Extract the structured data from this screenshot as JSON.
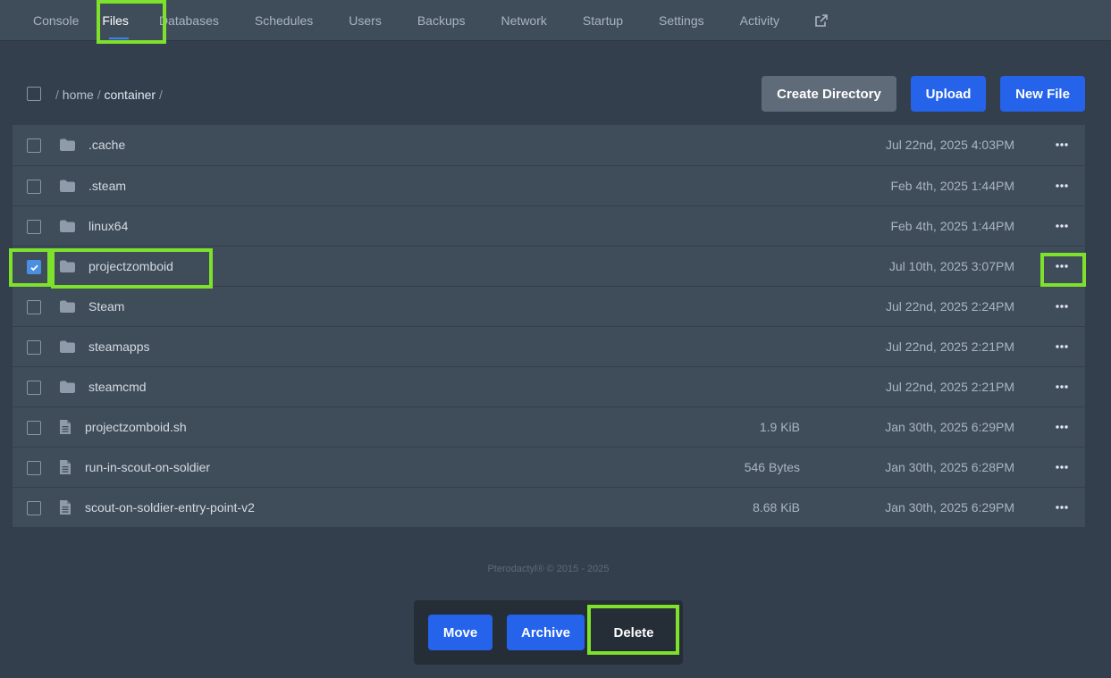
{
  "nav": {
    "tabs": [
      {
        "label": "Console"
      },
      {
        "label": "Files"
      },
      {
        "label": "Databases"
      },
      {
        "label": "Schedules"
      },
      {
        "label": "Users"
      },
      {
        "label": "Backups"
      },
      {
        "label": "Network"
      },
      {
        "label": "Startup"
      },
      {
        "label": "Settings"
      },
      {
        "label": "Activity"
      }
    ],
    "active_tab": "Files",
    "external_icon": "external-link-icon"
  },
  "breadcrumb": {
    "sep": "/",
    "parts": [
      "home",
      "container"
    ]
  },
  "actions": {
    "create_directory": "Create Directory",
    "upload": "Upload",
    "new_file": "New File"
  },
  "files": [
    {
      "name": ".cache",
      "type": "folder",
      "size": "",
      "date": "Jul 22nd, 2025 4:03PM",
      "checked": false
    },
    {
      "name": ".steam",
      "type": "folder",
      "size": "",
      "date": "Feb 4th, 2025 1:44PM",
      "checked": false
    },
    {
      "name": "linux64",
      "type": "folder",
      "size": "",
      "date": "Feb 4th, 2025 1:44PM",
      "checked": false
    },
    {
      "name": "projectzomboid",
      "type": "folder",
      "size": "",
      "date": "Jul 10th, 2025 3:07PM",
      "checked": true
    },
    {
      "name": "Steam",
      "type": "folder",
      "size": "",
      "date": "Jul 22nd, 2025 2:24PM",
      "checked": false
    },
    {
      "name": "steamapps",
      "type": "folder",
      "size": "",
      "date": "Jul 22nd, 2025 2:21PM",
      "checked": false
    },
    {
      "name": "steamcmd",
      "type": "folder",
      "size": "",
      "date": "Jul 22nd, 2025 2:21PM",
      "checked": false
    },
    {
      "name": "projectzomboid.sh",
      "type": "file",
      "size": "1.9 KiB",
      "date": "Jan 30th, 2025 6:29PM",
      "checked": false
    },
    {
      "name": "run-in-scout-on-soldier",
      "type": "file",
      "size": "546 Bytes",
      "date": "Jan 30th, 2025 6:28PM",
      "checked": false
    },
    {
      "name": "scout-on-soldier-entry-point-v2",
      "type": "file",
      "size": "8.68 KiB",
      "date": "Jan 30th, 2025 6:29PM",
      "checked": false
    }
  ],
  "footer": "Pterodactyl® © 2015 - 2025",
  "bulk": {
    "move": "Move",
    "archive": "Archive",
    "delete": "Delete"
  },
  "colors": {
    "accent_blue": "#2563eb",
    "highlight": "#7ee12b",
    "background": "#333f4d",
    "panel": "#3f4d5a"
  }
}
